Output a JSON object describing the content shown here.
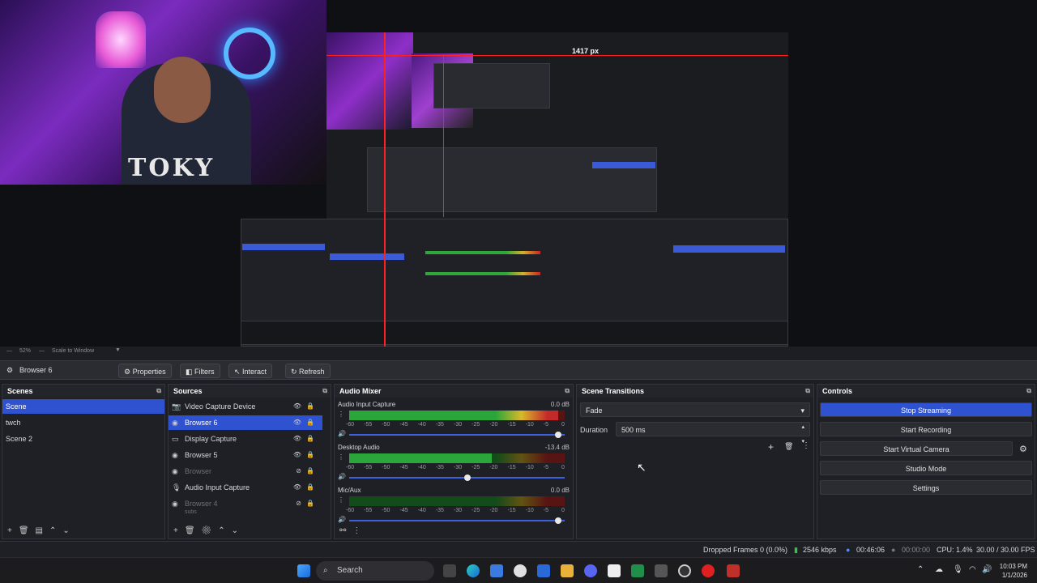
{
  "preview": {
    "measure_label": "1417 px",
    "zoom": "52%",
    "scale_mode": "Scale to Window",
    "cam_text": "TOKY"
  },
  "toolbar": {
    "source_name": "Browser 6",
    "properties": "Properties",
    "filters": "Filters",
    "interact": "Interact",
    "refresh": "Refresh"
  },
  "scenes": {
    "title": "Scenes",
    "items": [
      "Scene",
      "twch",
      "Scene 2"
    ]
  },
  "sources": {
    "title": "Sources",
    "items": [
      "Video Capture Device",
      "Browser 6",
      "Display Capture",
      "Browser 5",
      "Browser",
      "Audio Input Capture",
      "Browser 4",
      "subs"
    ]
  },
  "mixer": {
    "title": "Audio Mixer",
    "channels": [
      {
        "name": "Audio Input Capture",
        "db": "0.0 dB",
        "level": 0.97,
        "volume": 0.97
      },
      {
        "name": "Desktop Audio",
        "db": "-13.4 dB",
        "level": 0.66,
        "volume": 0.55
      },
      {
        "name": "Mic/Aux",
        "db": "0.0 dB",
        "level": 0.0,
        "volume": 0.97
      }
    ],
    "ticks": [
      "-60",
      "-55",
      "-50",
      "-45",
      "-40",
      "-35",
      "-30",
      "-25",
      "-20",
      "-15",
      "-10",
      "-5",
      "0"
    ]
  },
  "transitions": {
    "title": "Scene Transitions",
    "selected": "Fade",
    "duration_label": "Duration",
    "duration_value": "500 ms"
  },
  "controls": {
    "title": "Controls",
    "stop_streaming": "Stop Streaming",
    "start_recording": "Start Recording",
    "start_virtual_camera": "Start Virtual Camera",
    "studio_mode": "Studio Mode",
    "settings": "Settings"
  },
  "status": {
    "dropped": "Dropped Frames 0 (0.0%)",
    "bitrate": "2546 kbps",
    "stream_time": "00:46:06",
    "rec_time": "00:00:00",
    "cpu": "CPU: 1.4%",
    "fps": "30.00 / 30.00 FPS"
  },
  "taskbar": {
    "search": "Search",
    "time": "10:03 PM",
    "date": "1/1/2026"
  },
  "colors": {
    "accent": "#2f53d0",
    "meter_green": "#2ba63a",
    "meter_yellow": "#d9b92a",
    "meter_red": "#c32a2a",
    "guide_red": "#ff2020"
  },
  "icons": {
    "window": [
      "minimize-icon",
      "maximize-icon",
      "close-icon"
    ],
    "toolbar": [
      "gear-icon",
      "filter-icon",
      "cursor-icon",
      "refresh-icon"
    ],
    "sources": [
      "eye-icon",
      "lock-icon",
      "monitor-icon",
      "globe-icon",
      "microphone-icon",
      "camera-icon"
    ],
    "footer": [
      "add-icon",
      "remove-icon",
      "filter-icon",
      "up-icon",
      "down-icon",
      "gear-icon",
      "more-icon"
    ],
    "taskbar": [
      "windows-icon",
      "search-icon",
      "edge-icon",
      "folder-icon",
      "obs-icon",
      "chrome-icon"
    ]
  }
}
